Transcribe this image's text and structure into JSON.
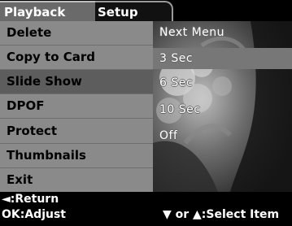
{
  "tabs": [
    {
      "label": "Playback"
    },
    {
      "label": "Setup"
    }
  ],
  "menu": {
    "items": [
      {
        "label": "Delete"
      },
      {
        "label": "Copy to Card"
      },
      {
        "label": "Slide Show"
      },
      {
        "label": "DPOF"
      },
      {
        "label": "Protect"
      },
      {
        "label": "Thumbnails"
      },
      {
        "label": "Exit"
      }
    ]
  },
  "submenu": {
    "options": [
      {
        "label": "Next Menu"
      },
      {
        "label": "3 Sec"
      },
      {
        "label": "6 Sec"
      },
      {
        "label": "10 Sec"
      },
      {
        "label": "Off"
      }
    ]
  },
  "footer": {
    "return_hint": "◄:Return",
    "ok_hint": "OK:Adjust",
    "select_hint": "▼ or ▲:Select Item"
  }
}
